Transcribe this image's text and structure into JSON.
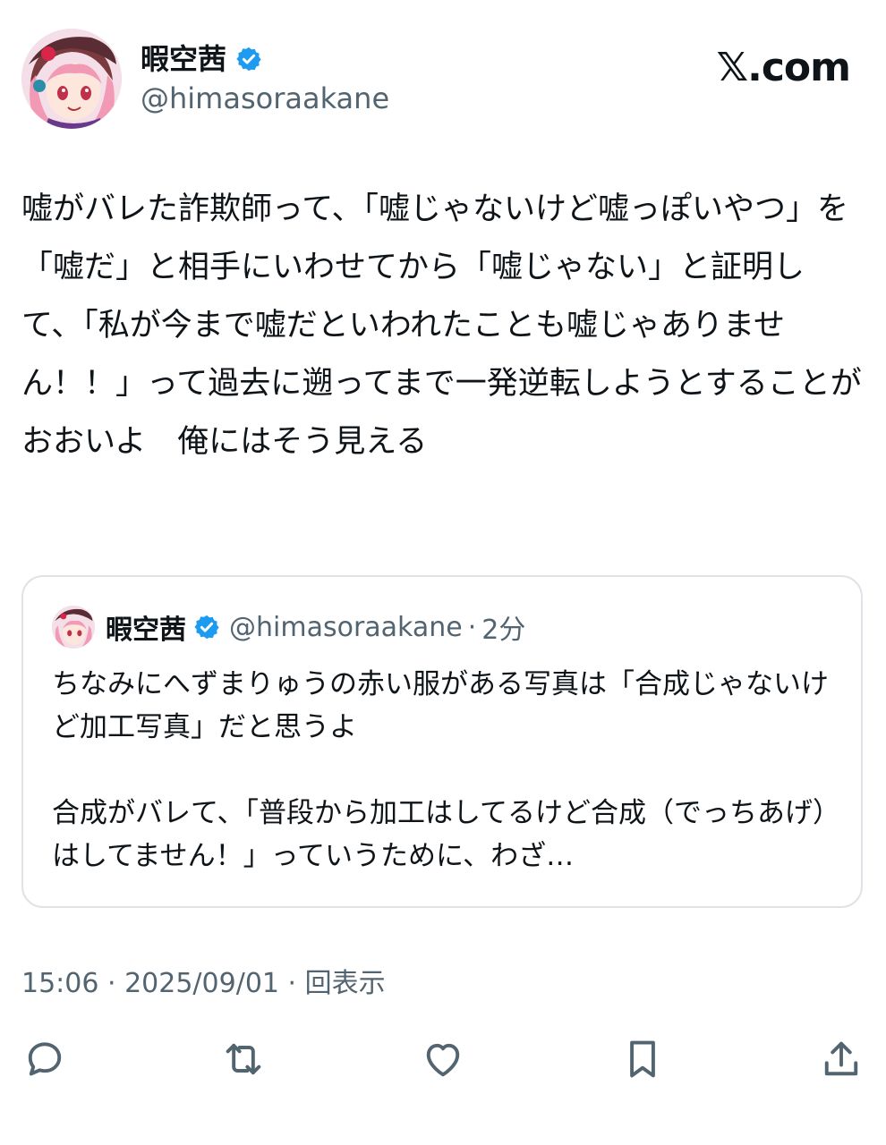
{
  "author": {
    "display_name": "暇空茜",
    "handle": "@himasoraakane"
  },
  "brand": {
    "label": "𝕏.com"
  },
  "tweet": {
    "text": "嘘がバレた詐欺師って、「嘘じゃないけど嘘っぽいやつ」を「嘘だ」と相手にいわせてから「嘘じゃない」と証明して、「私が今まで嘘だといわれたことも嘘じゃありません！！」って過去に遡ってまで一発逆転しようとすることがおおいよ　俺にはそう見える"
  },
  "quote": {
    "display_name": "暇空茜",
    "handle": "@himasoraakane",
    "separator": "·",
    "time": "2分",
    "text": "ちなみにへずまりゅうの赤い服がある写真は「合成じゃないけど加工写真」だと思うよ\n\n合成がバレて、「普段から加工はしてるけど合成（でっちあげ）はしてません！」っていうために、わざ…"
  },
  "meta": {
    "time": "15:06",
    "sep1": " · ",
    "date": "2025/09/01",
    "sep2": " · ",
    "views": "回表示"
  },
  "actions": {
    "icons": [
      "reply-icon",
      "retweet-icon",
      "like-icon",
      "bookmark-icon",
      "share-icon"
    ]
  },
  "colors": {
    "text": "#0f1419",
    "secondary": "#536471",
    "verified": "#1d9bf0",
    "border": "#dfe3e7"
  }
}
